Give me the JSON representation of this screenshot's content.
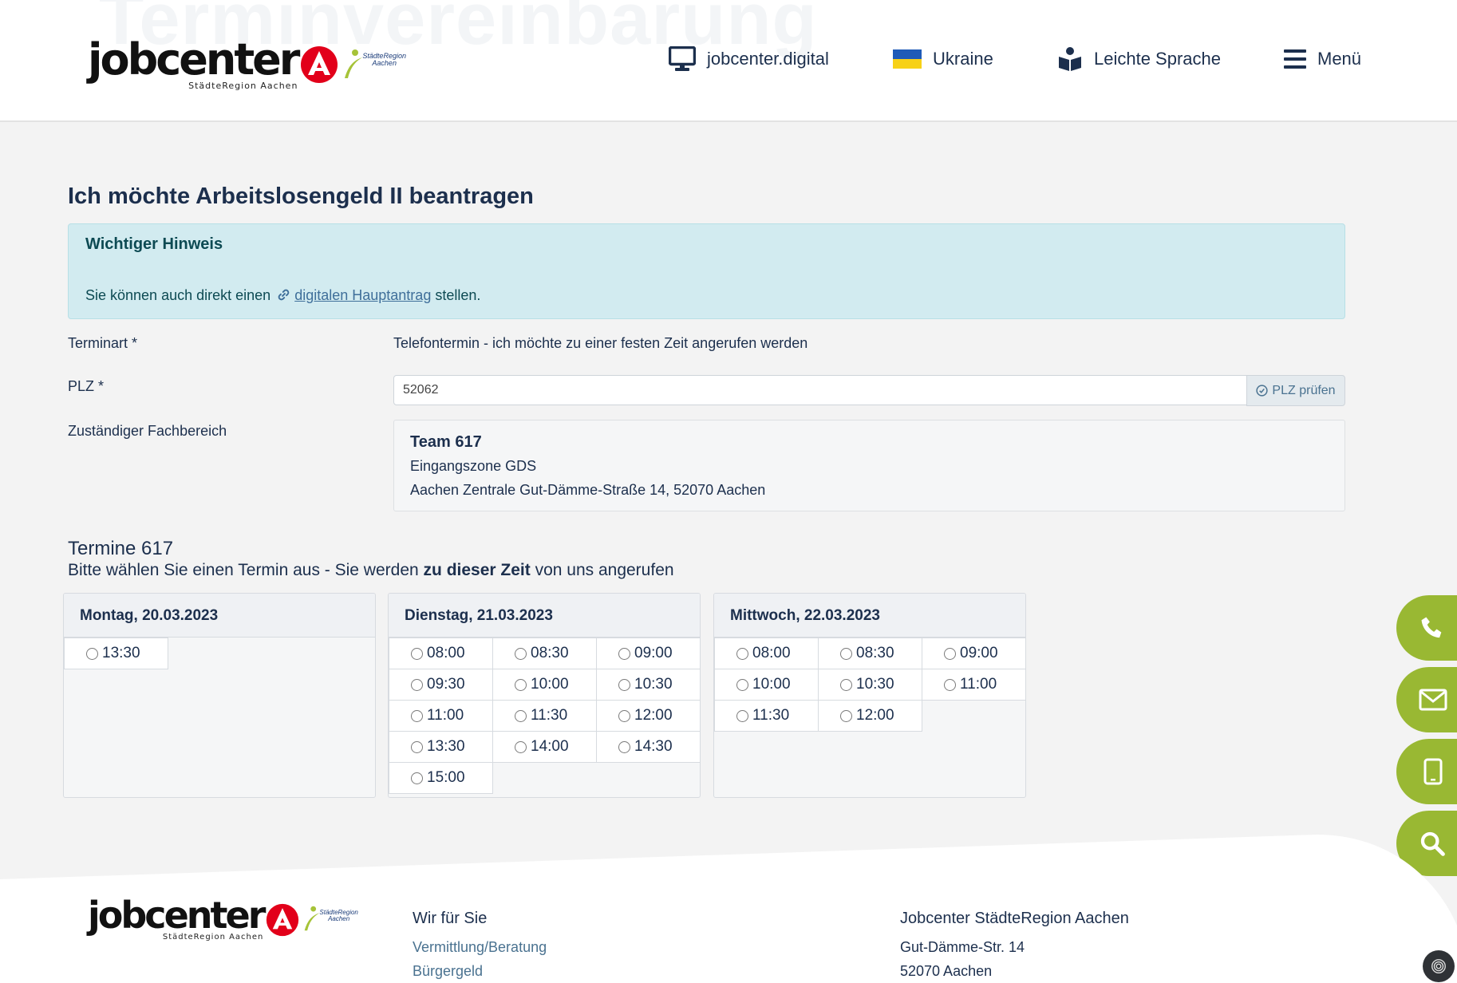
{
  "header": {
    "bg_title": "Terminvereinbarung",
    "logo": {
      "word": "jobcenter",
      "sub": "StädteRegion Aachen",
      "city_1": "StädteRegion",
      "city_2": "Aachen"
    },
    "nav": [
      {
        "label": "jobcenter.digital",
        "icon": "monitor-icon"
      },
      {
        "label": "Ukraine",
        "icon": "ukraine-flag-icon"
      },
      {
        "label": "Leichte Sprache",
        "icon": "easy-language-icon"
      },
      {
        "label": "Menü",
        "icon": "hamburger-menu-icon"
      }
    ],
    "flag_colors": [
      "#1f5bb8",
      "#f7d117"
    ]
  },
  "main": {
    "title": "Ich möchte Arbeitslosengeld II beantragen",
    "notice": {
      "title": "Wichtiger Hinweis",
      "text_before": "Sie können auch direkt einen",
      "link": "digitalen Hauptantrag",
      "text_after": "stellen."
    },
    "fields": {
      "terminart_label": "Terminart *",
      "terminart_value": "Telefontermin - ich möchte zu einer festen Zeit angerufen werden",
      "plz_label": "PLZ *",
      "plz_value": "52062",
      "plz_button": "PLZ prüfen",
      "fachbereich_label": "Zuständiger Fachbereich"
    },
    "team": {
      "name": "Team 617",
      "line2": "Eingangszone GDS",
      "line3": "Aachen Zentrale Gut-Dämme-Straße 14, 52070 Aachen"
    },
    "termine": {
      "title": "Termine 617",
      "sub_before": "Bitte wählen Sie einen Termin aus - Sie werden",
      "sub_bold": "zu dieser Zeit",
      "sub_after": "von uns angerufen",
      "days": [
        {
          "label": "Montag, 20.03.2023",
          "slots": [
            "13:30"
          ]
        },
        {
          "label": "Dienstag, 21.03.2023",
          "slots": [
            "08:00",
            "08:30",
            "09:00",
            "09:30",
            "10:00",
            "10:30",
            "11:00",
            "11:30",
            "12:00",
            "13:30",
            "14:00",
            "14:30",
            "15:00"
          ]
        },
        {
          "label": "Mittwoch, 22.03.2023",
          "slots": [
            "08:00",
            "08:30",
            "09:00",
            "10:00",
            "10:30",
            "11:00",
            "11:30",
            "12:00"
          ]
        }
      ]
    }
  },
  "side_buttons": [
    "phone-icon",
    "mail-icon",
    "mobile-icon",
    "search-icon"
  ],
  "accent_color": "#99b833",
  "footer": {
    "col1_title": "Wir für Sie",
    "col1_links": [
      "Vermittlung/Beratung",
      "Bürgergeld"
    ],
    "col2_title": "Jobcenter StädteRegion Aachen",
    "col2_lines": [
      "Gut-Dämme-Str. 14",
      "52070 Aachen"
    ]
  }
}
